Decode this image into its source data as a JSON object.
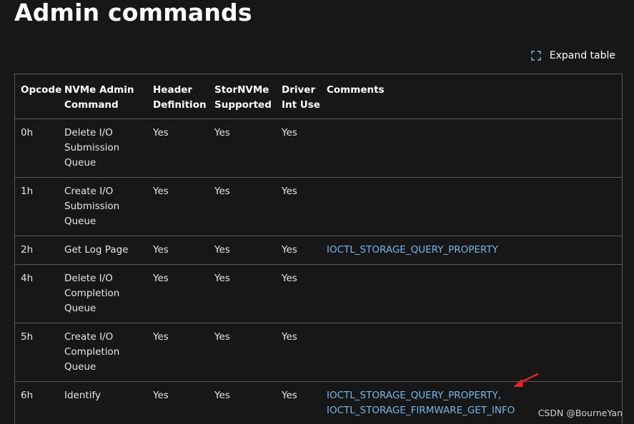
{
  "page": {
    "title": "Admin commands",
    "expand_label": "Expand table",
    "watermark": "CSDN @BourneYan"
  },
  "table": {
    "headers": [
      [
        "Opcode"
      ],
      [
        "NVMe Admin",
        "Command"
      ],
      [
        "Header",
        "Definition"
      ],
      [
        "StorNVMe",
        "Supported"
      ],
      [
        "Driver",
        "Int Use"
      ],
      [
        "Comments"
      ]
    ],
    "rows": [
      {
        "opcode": "0h",
        "command": [
          "Delete I/O",
          "Submission",
          "Queue"
        ],
        "header_def": "Yes",
        "stornvme": "Yes",
        "driver": "Yes",
        "comments": []
      },
      {
        "opcode": "1h",
        "command": [
          "Create I/O",
          "Submission",
          "Queue"
        ],
        "header_def": "Yes",
        "stornvme": "Yes",
        "driver": "Yes",
        "comments": []
      },
      {
        "opcode": "2h",
        "command": [
          "Get Log Page"
        ],
        "header_def": "Yes",
        "stornvme": "Yes",
        "driver": "Yes",
        "comments": [
          "IOCTL_STORAGE_QUERY_PROPERTY"
        ]
      },
      {
        "opcode": "4h",
        "command": [
          "Delete I/O",
          "Completion",
          "Queue"
        ],
        "header_def": "Yes",
        "stornvme": "Yes",
        "driver": "Yes",
        "comments": []
      },
      {
        "opcode": "5h",
        "command": [
          "Create I/O",
          "Completion",
          "Queue"
        ],
        "header_def": "Yes",
        "stornvme": "Yes",
        "driver": "Yes",
        "comments": []
      },
      {
        "opcode": "6h",
        "command": [
          "Identify"
        ],
        "header_def": "Yes",
        "stornvme": "Yes",
        "driver": "Yes",
        "comments": [
          "IOCTL_STORAGE_QUERY_PROPERTY,",
          "IOCTL_STORAGE_FIRMWARE_GET_INFO"
        ]
      }
    ]
  },
  "colors": {
    "background": "#171717",
    "border": "#5a5a5a",
    "link": "#75b6e7",
    "annotation_arrow": "#e8241e"
  },
  "icons": {
    "expand": "expand-corners-icon",
    "annotation": "red-arrow-icon"
  }
}
